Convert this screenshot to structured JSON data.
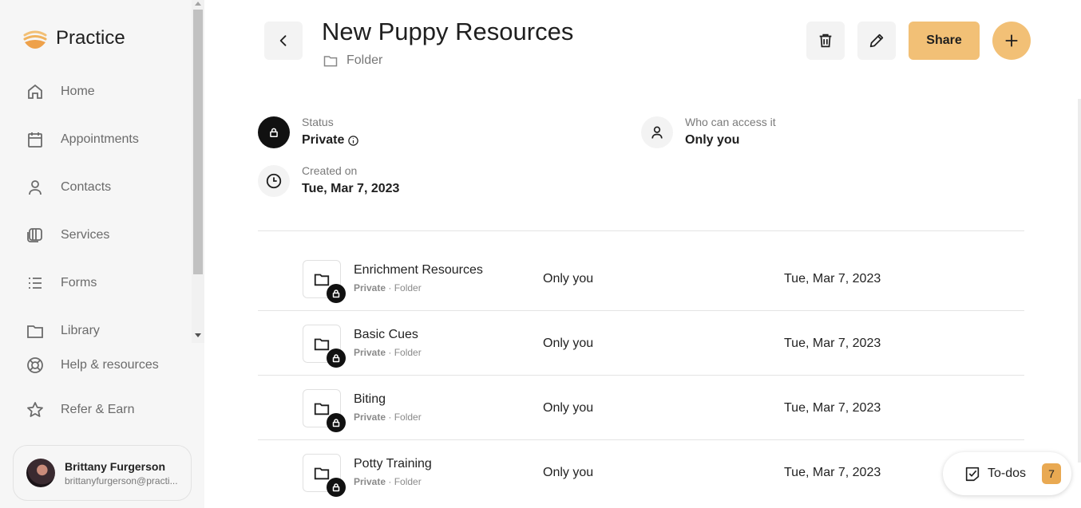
{
  "app": {
    "name": "Practice"
  },
  "sidebar": {
    "items": [
      {
        "label": "Home",
        "icon": "home-icon"
      },
      {
        "label": "Appointments",
        "icon": "calendar-icon"
      },
      {
        "label": "Contacts",
        "icon": "person-icon"
      },
      {
        "label": "Services",
        "icon": "services-icon"
      },
      {
        "label": "Forms",
        "icon": "list-icon"
      },
      {
        "label": "Library",
        "icon": "folder-icon"
      },
      {
        "label": "Help & resources",
        "icon": "lifebuoy-icon"
      },
      {
        "label": "Refer & Earn",
        "icon": "star-icon"
      }
    ],
    "user": {
      "name": "Brittany Furgerson",
      "email": "brittanyfurgerson@practi..."
    }
  },
  "header": {
    "title": "New Puppy Resources",
    "subtitle": "Folder",
    "share_label": "Share"
  },
  "details": {
    "status_label": "Status",
    "status_value": "Private",
    "access_label": "Who can access it",
    "access_value": "Only you",
    "created_label": "Created on",
    "created_value": "Tue, Mar 7, 2023"
  },
  "items": [
    {
      "name": "Enrichment Resources",
      "privacy": "Private",
      "type": "Folder",
      "access": "Only you",
      "date": "Tue, Mar 7, 2023"
    },
    {
      "name": "Basic Cues",
      "privacy": "Private",
      "type": "Folder",
      "access": "Only you",
      "date": "Tue, Mar 7, 2023"
    },
    {
      "name": "Biting",
      "privacy": "Private",
      "type": "Folder",
      "access": "Only you",
      "date": "Tue, Mar 7, 2023"
    },
    {
      "name": "Potty Training",
      "privacy": "Private",
      "type": "Folder",
      "access": "Only you",
      "date": "Tue, Mar 7, 2023"
    }
  ],
  "todos": {
    "label": "To-dos",
    "count": "7"
  },
  "colors": {
    "accent": "#f2c076",
    "badge": "#e9a952"
  }
}
